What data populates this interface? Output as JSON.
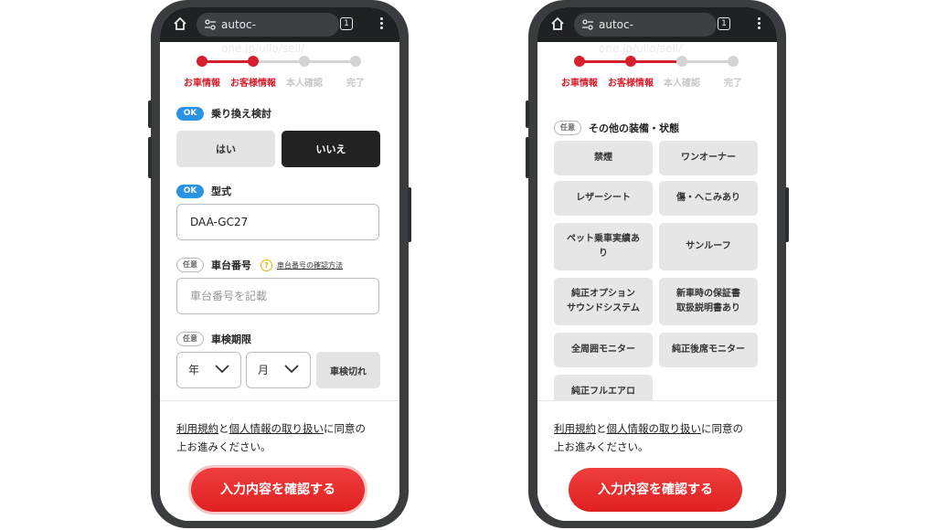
{
  "browser": {
    "url": "autoc-one.jp/ullo/sell/",
    "tab_count": "1"
  },
  "stepper": {
    "steps": [
      "お車情報",
      "お客様情報",
      "本人確認",
      "完了"
    ],
    "active_through": 2,
    "colors": {
      "active": "#d6202e",
      "inactive": "#d4d4d4"
    }
  },
  "left_form": {
    "transfer": {
      "badge": "OK",
      "label": "乗り換え検討",
      "options": [
        "はい",
        "いいえ"
      ],
      "selected": "いいえ"
    },
    "model": {
      "badge": "OK",
      "label": "型式",
      "value": "DAA-GC27"
    },
    "chassis": {
      "badge": "任意",
      "label": "車台番号",
      "help_link": "車台番号の確認方法",
      "placeholder": "車台番号を記載"
    },
    "inspection": {
      "badge": "任意",
      "label": "車検期限",
      "year": "年",
      "month": "月",
      "expired_button": "車検切れ"
    }
  },
  "right_form": {
    "equipment": {
      "badge": "任意",
      "label": "その他の装備・状態",
      "options": [
        [
          "禁煙"
        ],
        [
          "ワンオーナー"
        ],
        [
          "レザーシート"
        ],
        [
          "傷・へこみあり"
        ],
        [
          "ペット乗車実績あ",
          "り"
        ],
        [
          "サンルーフ"
        ],
        [
          "純正オプション",
          "サウンドシステム"
        ],
        [
          "新車時の保証書",
          "取扱説明書あり"
        ],
        [
          "全周囲モニター"
        ],
        [
          "純正後席モニター"
        ],
        [
          "純正フルエアロ"
        ]
      ]
    }
  },
  "footer": {
    "terms_link": "利用規約",
    "and": "と",
    "privacy_link": "個人情報の取り扱い",
    "consent_line1_rest": "に同意の",
    "consent_line2": "上お進みください。",
    "confirm_button": "入力内容を確認する"
  },
  "colors": {
    "brand_red": "#d6202e",
    "ok_blue": "#2b93e3",
    "phone_frame": "#3b3c40"
  }
}
